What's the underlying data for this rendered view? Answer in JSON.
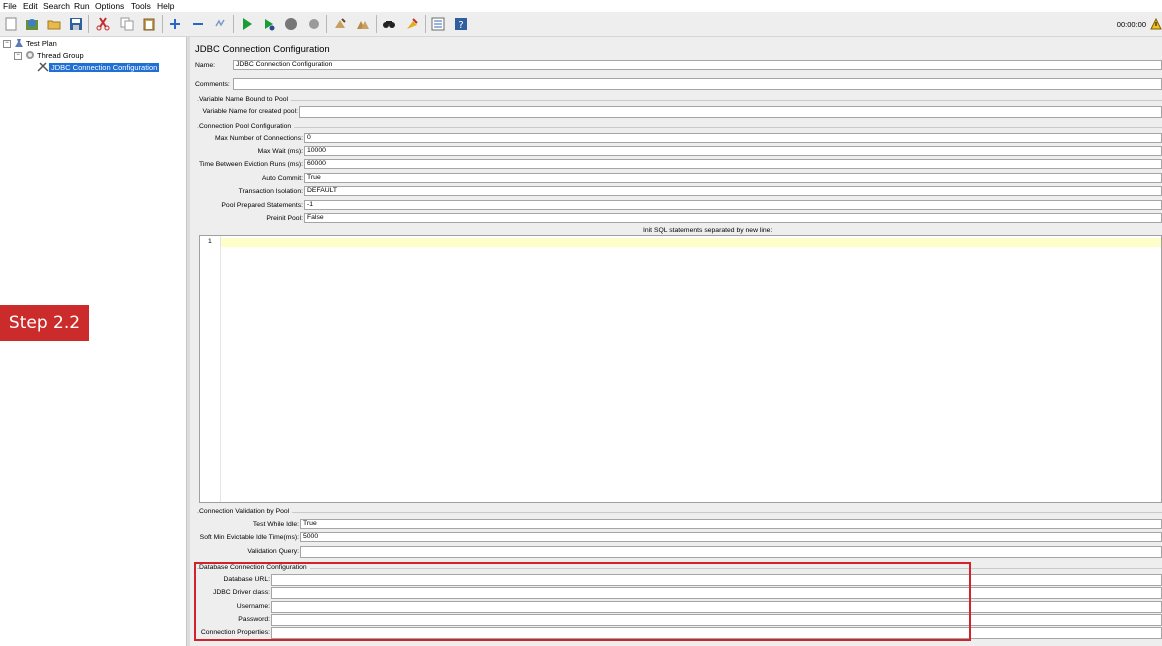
{
  "menu": [
    "File",
    "Edit",
    "Search",
    "Run",
    "Options",
    "Tools",
    "Help"
  ],
  "toolbar": {
    "timer": "00:00:00",
    "icons": [
      "new-icon",
      "templates-icon",
      "open-icon",
      "save-icon",
      "cut-icon",
      "copy-icon",
      "paste-icon",
      "expand-icon",
      "collapse-icon",
      "toggle-icon",
      "start-icon",
      "start-no-pause-icon",
      "stop-icon",
      "shutdown-icon",
      "clear-icon",
      "clear-all-icon",
      "search-icon",
      "reset-search-icon",
      "function-helper-icon",
      "help-icon",
      "warning-icon"
    ]
  },
  "tree": {
    "items": [
      {
        "label": "Test Plan"
      },
      {
        "label": "Thread Group"
      },
      {
        "label": "JDBC Connection Configuration"
      }
    ]
  },
  "form": {
    "title": "JDBC Connection Configuration",
    "name_label": "Name:",
    "name_value": "JDBC Connection Configuration",
    "comments_label": "Comments:",
    "comments_value": "",
    "var_group": {
      "title": "Variable Name Bound to Pool",
      "label": "Variable Name for created pool:",
      "value": ""
    },
    "pool_group": {
      "title": "Connection Pool Configuration",
      "fields": [
        {
          "label": "Max Number of Connections:",
          "value": "0"
        },
        {
          "label": "Max Wait (ms):",
          "value": "10000"
        },
        {
          "label": "Time Between Eviction Runs (ms):",
          "value": "60000"
        },
        {
          "label": "Auto Commit:",
          "value": "True"
        },
        {
          "label": "Transaction Isolation:",
          "value": "DEFAULT"
        },
        {
          "label": "Pool Prepared Statements:",
          "value": "-1"
        },
        {
          "label": "Preinit Pool:",
          "value": "False"
        }
      ],
      "init_sql_label": "Init SQL statements separated by new line:",
      "line_number": "1"
    },
    "validation_group": {
      "title": "Connection Validation by Pool",
      "fields": [
        {
          "label": "Test While Idle:",
          "value": "True"
        },
        {
          "label": "Soft Min Evictable Idle Time(ms):",
          "value": "5000"
        },
        {
          "label": "Validation Query:",
          "value": ""
        }
      ]
    },
    "db_group": {
      "title": "Database Connection Configuration",
      "fields": [
        {
          "label": "Database URL:",
          "value": ""
        },
        {
          "label": "JDBC Driver class:",
          "value": ""
        },
        {
          "label": "Username:",
          "value": ""
        },
        {
          "label": "Password:",
          "value": ""
        },
        {
          "label": "Connection Properties:",
          "value": ""
        }
      ]
    }
  },
  "annotation": {
    "step_label": "Step 2.2",
    "highlight_color": "#d2232a"
  },
  "colors": {
    "selection": "#1f6fd4",
    "editor_highlight": "#fefec8"
  }
}
